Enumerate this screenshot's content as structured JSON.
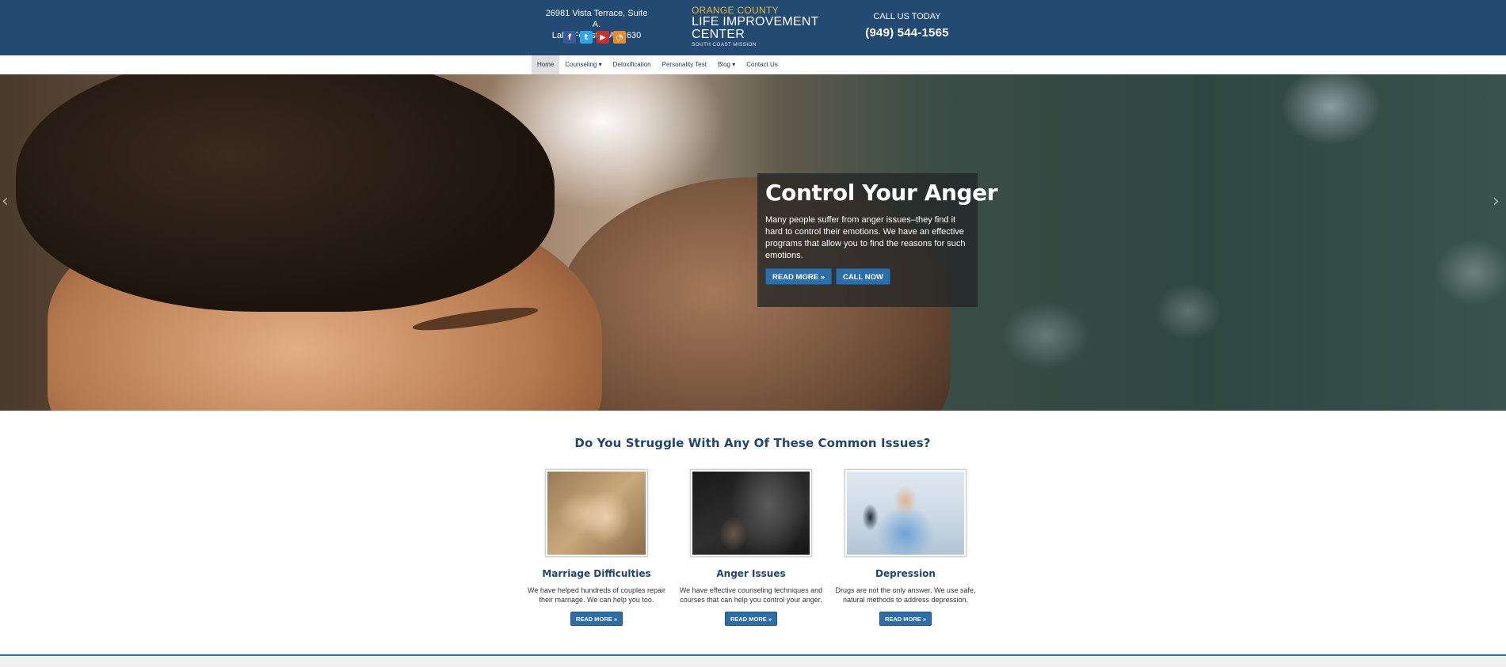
{
  "header": {
    "address_line1": "26981 Vista Terrace, Suite A.",
    "address_line2": "Lake Forest, CA 92630",
    "socials": [
      {
        "name": "facebook-icon",
        "glyph": "f"
      },
      {
        "name": "twitter-icon",
        "glyph": "t"
      },
      {
        "name": "youtube-icon",
        "glyph": "▶"
      },
      {
        "name": "rss-icon",
        "glyph": "◔"
      }
    ],
    "logo": {
      "line1": "ORANGE COUNTY",
      "line2": "LIFE IMPROVEMENT",
      "line3": "CENTER",
      "line4": "SOUTH COAST MISSION"
    },
    "call_label": "CALL US TODAY",
    "phone": "(949) 544-1565"
  },
  "nav": {
    "items": [
      {
        "label": "Home"
      },
      {
        "label": "Counseling ▾"
      },
      {
        "label": "Detoxification"
      },
      {
        "label": "Personality Test"
      },
      {
        "label": "Blog ▾"
      },
      {
        "label": "Contact Us"
      }
    ]
  },
  "hero": {
    "title": "Control Your Anger",
    "text": "Many people suffer from anger issues–they find it hard to control their emotions. We have an effective programs that allow you to find the reasons for such emotions.",
    "read_more": "READ MORE »",
    "call_now": "CALL NOW",
    "prev_arrow": "‹",
    "next_arrow": "›"
  },
  "issues": {
    "title": "Do You Struggle With Any Of These Common Issues?",
    "items": [
      {
        "title": "Marriage Difficulties",
        "text": "We have helped hundreds of couples repair their marriage. We can help you too.",
        "button": "READ MORE »"
      },
      {
        "title": "Anger Issues",
        "text": "We have effective counseling techniques and courses that can help you control your anger.",
        "button": "READ MORE »"
      },
      {
        "title": "Depression",
        "text": "Drugs are not the only answer. We use safe, natural methods to address depression.",
        "button": "READ MORE »"
      }
    ]
  },
  "colors": {
    "header_bg": "#234a72",
    "accent": "#2e6ea8",
    "logo_gold": "#e2b94a",
    "heading": "#24456b"
  }
}
